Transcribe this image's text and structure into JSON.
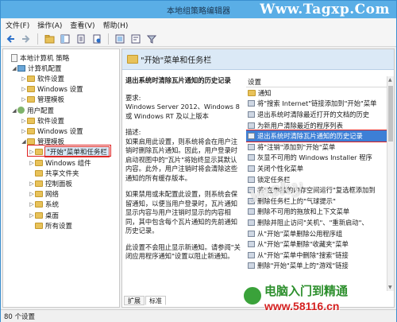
{
  "window": {
    "title": "本地组策略编辑器",
    "watermark_top": "Www.Tagxp.Com"
  },
  "menu": [
    "文件(F)",
    "操作(A)",
    "查看(V)",
    "帮助(H)"
  ],
  "tree": {
    "items": [
      {
        "label": "本地计算机 策略",
        "level": 0,
        "twisty": "",
        "icon": "doc"
      },
      {
        "label": "计算机配置",
        "level": 1,
        "twisty": "◢",
        "icon": "pc"
      },
      {
        "label": "软件设置",
        "level": 2,
        "twisty": "▷",
        "icon": "folder"
      },
      {
        "label": "Windows 设置",
        "level": 2,
        "twisty": "▷",
        "icon": "folder"
      },
      {
        "label": "管理模板",
        "level": 2,
        "twisty": "▷",
        "icon": "folder"
      },
      {
        "label": "用户配置",
        "level": 1,
        "twisty": "◢",
        "icon": "user"
      },
      {
        "label": "软件设置",
        "level": 2,
        "twisty": "▷",
        "icon": "folder"
      },
      {
        "label": "Windows 设置",
        "level": 2,
        "twisty": "▷",
        "icon": "folder"
      },
      {
        "label": "管理模板",
        "level": 2,
        "twisty": "◢",
        "icon": "folder"
      },
      {
        "label": "\"开始\"菜单和任务栏",
        "level": 3,
        "twisty": "▷",
        "icon": "folder",
        "selected": true
      },
      {
        "label": "Windows 组件",
        "level": 3,
        "twisty": "▷",
        "icon": "folder"
      },
      {
        "label": "共享文件夹",
        "level": 3,
        "twisty": "",
        "icon": "folder"
      },
      {
        "label": "控制面板",
        "level": 3,
        "twisty": "▷",
        "icon": "folder"
      },
      {
        "label": "网络",
        "level": 3,
        "twisty": "▷",
        "icon": "folder"
      },
      {
        "label": "系统",
        "level": 3,
        "twisty": "▷",
        "icon": "folder"
      },
      {
        "label": "桌面",
        "level": 3,
        "twisty": "▷",
        "icon": "folder"
      },
      {
        "label": "所有设置",
        "level": 3,
        "twisty": "",
        "icon": "folder"
      }
    ]
  },
  "right": {
    "header": "\"开始\"菜单和任务栏",
    "desc_title": "退出系统时清除瓦片通知的历史记录",
    "req_label": "要求:",
    "req_text": "Windows Server 2012、Windows 8 或 Windows RT 及以上版本",
    "desc_label": "描述:",
    "desc_p1": "如果启用此设置，则系统将会在用户注销时删除瓦片通知。因此，用户登录时启动视图中的\"瓦片\"将始终显示其默认内容。此外，用户注销时将会清除这些通知的所有缓存版本。",
    "desc_p2": "如果禁用或未配置此设置，则系统会保留通知，以便当用户登录时，瓦片通知显示内容与用户注销时显示的内容相同，其中包含每个瓦片通知的先前通知历史记录。",
    "desc_p3": "此设置不会阻止显示新通知。请参阅\"关闭应用程序通知\"设置以阻止新通知。",
    "settings_col": "设置",
    "settings": [
      "通知",
      "将\"搜索 Internet\"链接添加到\"开始\"菜单",
      "退出系统时清除最近打开的文档的历史",
      "为新用户清除最近的程序列表",
      "退出系统时清除瓦片通知的历史记录",
      "将\"注销\"添加到\"开始\"菜单",
      "灰显不可用的 Windows Installer 程序",
      "关闭个性化菜单",
      "锁定任务栏",
      "将\"在单独的内存空间运行\"复选框添加到",
      "删除任务栏上的\"气球提示\"",
      "删除不可用的拖放和上下文菜单",
      "删除并阻止访问\"关机\"、\"重新启动\"、",
      "从\"开始\"菜单删除公用程序组",
      "从\"开始\"菜单删除\"收藏夹\"菜单",
      "从\"开始\"菜单中删除\"搜索\"链接",
      "删除\"开始\"菜单上的\"游戏\"链接"
    ],
    "tabs": [
      "扩展",
      "标准"
    ]
  },
  "status": "80 个设置",
  "watermarks": {
    "center": "yesky",
    "bottom_line1": "电脑入门到精通",
    "bottom_line2": "www.58116.cn"
  }
}
